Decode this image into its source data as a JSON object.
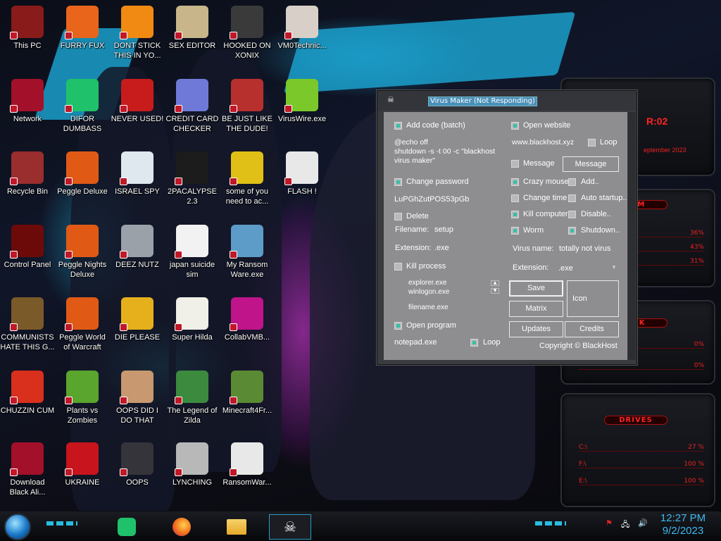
{
  "desktop_icons": [
    {
      "label": "This PC",
      "icon": "computer-icon",
      "color": "#8a1b1b"
    },
    {
      "label": "FURRY FUX",
      "icon": "firefox-icon",
      "color": "#e8651b"
    },
    {
      "label": "DONT STICK THIS IN YO...",
      "icon": "vlc-cone-icon",
      "color": "#f08a12"
    },
    {
      "label": "SEX EDITOR",
      "icon": "hxd-editor-icon",
      "color": "#c8b68a"
    },
    {
      "label": "HOOKED ON XONIX",
      "icon": "xonix-game-icon",
      "color": "#3a3a3a"
    },
    {
      "label": "VM0Technic...",
      "icon": "doctor-icon",
      "color": "#d8d0c8"
    },
    {
      "label": "Network",
      "icon": "alien-orb-icon",
      "color": "#a3102a"
    },
    {
      "label": "DIFOR DUMBASS",
      "icon": "notes-icon",
      "color": "#1fc26a"
    },
    {
      "label": "NEVER USED!",
      "icon": "devcpp-icon",
      "color": "#c81c1c"
    },
    {
      "label": "CREDIT CARD CHECKER",
      "icon": "credit-card-icon",
      "color": "#6f7ad8"
    },
    {
      "label": "BE JUST LIKE THE DUDE!",
      "icon": "santa-icon",
      "color": "#b8302e"
    },
    {
      "label": "VirusWire.exe",
      "icon": "lime-icon",
      "color": "#7ac82a"
    },
    {
      "label": "Recycle Bin",
      "icon": "recycle-bin-icon",
      "color": "#9a2d2d"
    },
    {
      "label": "Peggle Deluxe",
      "icon": "peggle-icon",
      "color": "#e05a16"
    },
    {
      "label": "ISRAEL SPY",
      "icon": "spy-folder-icon",
      "color": "#dfe7ef"
    },
    {
      "label": "2PACALYPSE 2.3",
      "icon": "terminal-icon",
      "color": "#1c1c1c"
    },
    {
      "label": "some of you need to ac...",
      "icon": "dog-icon",
      "color": "#e0c016"
    },
    {
      "label": "FLASH !",
      "icon": "flash-document-icon",
      "color": "#e8e8e8"
    },
    {
      "label": "Control Panel",
      "icon": "control-panel-icon",
      "color": "#6c0a0a"
    },
    {
      "label": "Peggle Nights Deluxe",
      "icon": "peggle-nights-icon",
      "color": "#e05a16"
    },
    {
      "label": "DEEZ NUTZ",
      "icon": "stacked-windows-icon",
      "color": "#9aa1a8"
    },
    {
      "label": "japan suicide sim",
      "icon": "document-icon",
      "color": "#f2f2f2"
    },
    {
      "label": "My Ransom Ware.exe",
      "icon": "window-app-icon",
      "color": "#5d9cc8"
    },
    {
      "label": "COMMUNISTS HATE THIS G...",
      "icon": "money-bag-icon",
      "color": "#7b5a2a"
    },
    {
      "label": "Peggle World of Warcraft",
      "icon": "peggle-wow-icon",
      "color": "#e05a16"
    },
    {
      "label": "DIE PLEASE",
      "icon": "de-app-icon",
      "color": "#e6b01c"
    },
    {
      "label": "Super Hilda",
      "icon": "pixel-cat-icon",
      "color": "#f0efe8"
    },
    {
      "label": "CollabVMB...",
      "icon": "collab-vm-icon",
      "color": "#c0148a"
    },
    {
      "label": "CHUZZIN CUM",
      "icon": "chuzzle-icon",
      "color": "#d8301c"
    },
    {
      "label": "Plants vs Zombies",
      "icon": "plant-icon",
      "color": "#5aa52e"
    },
    {
      "label": "OOPS DID I DO THAT",
      "icon": "portrait-icon",
      "color": "#c89870"
    },
    {
      "label": "The Legend of Zilda",
      "icon": "zelda-icon",
      "color": "#3c8a3e"
    },
    {
      "label": "Minecraft4Fr...",
      "icon": "grass-block-icon",
      "color": "#5b8a34"
    },
    {
      "label": "Download Black Ali...",
      "icon": "alien-orb-icon",
      "color": "#a3102a"
    },
    {
      "label": "UKRAINE",
      "icon": "radiation-icon",
      "color": "#c8141c"
    },
    {
      "label": "OOPS",
      "icon": "terminal-window-icon",
      "color": "#34343a"
    },
    {
      "label": "LYNCHING",
      "icon": "knot-icon",
      "color": "#b8b8b8"
    },
    {
      "label": "RansomWar...",
      "icon": "skull-icon",
      "color": "#e8e8e8"
    }
  ],
  "window": {
    "title": "Virus Maker (Not Responding)",
    "add_code_label": "Add code (batch)",
    "batch_code": "@echo off\nshutdown -s -t 00 -c \"blackhost\nvirus maker\"",
    "change_password_label": "Change password",
    "password_value": "LuPGhZutPOS53pGb",
    "delete_label": "Delete",
    "filename_label": "Filename:",
    "filename_value": "setup",
    "extension_label": "Extension:",
    "extension_value": ".exe",
    "kill_process_label": "Kill process",
    "processes": [
      "explorer.exe",
      "winlogon.exe"
    ],
    "process_filename": "filename.exe",
    "open_program_label": "Open program",
    "program_value": "notepad.exe",
    "loop_label_program": "Loop",
    "open_website_label": "Open website",
    "website_value": "www.blackhost.xyz",
    "loop_label_website": "Loop",
    "message_check_label": "Message",
    "message_button": "Message",
    "crazy_mouse_label": "Crazy mouse",
    "add_label": "Add..",
    "change_time_label": "Change time",
    "auto_startup_label": "Auto startup..",
    "kill_computer_label": "Kill computer",
    "disable_label": "Disable..",
    "worm_label": "Worm",
    "shutdown_label": "Shutdown..",
    "virus_name_label": "Virus name:",
    "virus_name_value": "totally not virus",
    "extension2_label": "Extension:",
    "extension2_value": ".exe",
    "save_button": "Save",
    "icon_button": "Icon",
    "matrix_button": "Matrix",
    "updates_button": "Updates",
    "credits_button": "Credits",
    "copyright": "Copyright © BlackHost",
    "checked": {
      "add_code": true,
      "change_password": true,
      "delete": false,
      "kill_process": false,
      "open_program": true,
      "loop_program": true,
      "open_website": true,
      "loop_website": false,
      "message": false,
      "crazy_mouse": true,
      "add": false,
      "change_time": false,
      "auto_startup": false,
      "kill_computer": true,
      "disable": false,
      "worm": true,
      "shutdown": true
    }
  },
  "gadgets": {
    "clock_fragment": "R:02",
    "date_fragment": "eptember 2023",
    "system_title": "TEM",
    "system_values": [
      "36%",
      "43%",
      "31%"
    ],
    "network_title": "ORK",
    "network_values": [
      "0%",
      "0%"
    ],
    "drives_title": "DRIVES",
    "drives": [
      {
        "name": "C:\\",
        "value": "27 %"
      },
      {
        "name": "F:\\",
        "value": "100 %"
      },
      {
        "name": "E:\\",
        "value": "100 %"
      }
    ]
  },
  "taskbar": {
    "apps": [
      "notes-icon",
      "firefox-icon",
      "file-explorer-icon",
      "virus-maker-icon"
    ],
    "time": "12:27 PM",
    "date": "9/2/2023"
  }
}
